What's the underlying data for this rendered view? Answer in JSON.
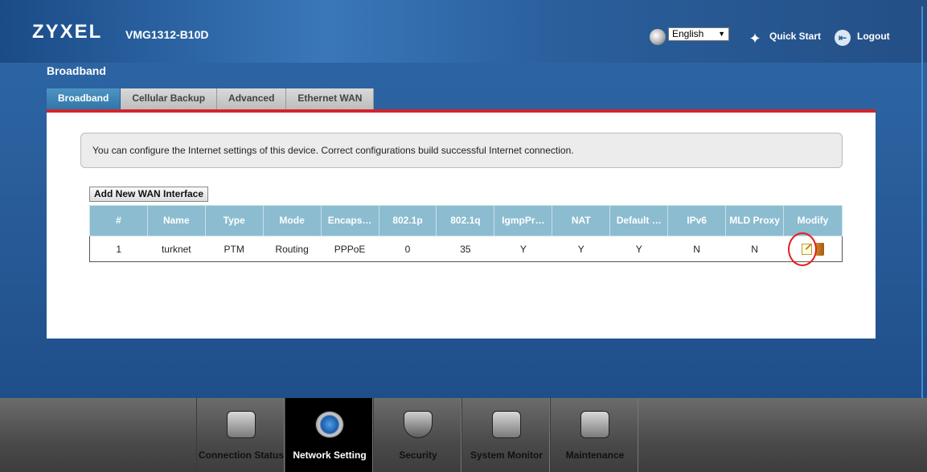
{
  "header": {
    "logo": "ZYXEL",
    "model": "VMG1312-B10D",
    "language": "English",
    "quick_start": "Quick Start",
    "logout": "Logout"
  },
  "page": {
    "title": "Broadband"
  },
  "tabs": [
    {
      "label": "Broadband",
      "active": true
    },
    {
      "label": "Cellular Backup",
      "active": false
    },
    {
      "label": "Advanced",
      "active": false
    },
    {
      "label": "Ethernet WAN",
      "active": false
    }
  ],
  "info": "You can configure the Internet settings of this device. Correct configurations build successful Internet connection.",
  "add_button": "Add New WAN Interface",
  "table": {
    "headers": [
      "#",
      "Name",
      "Type",
      "Mode",
      "Encaps…",
      "802.1p",
      "802.1q",
      "IgmpPr…",
      "NAT",
      "Default …",
      "IPv6",
      "MLD Proxy",
      "Modify"
    ],
    "rows": [
      [
        "1",
        "turknet",
        "PTM",
        "Routing",
        "PPPoE",
        "0",
        "35",
        "Y",
        "Y",
        "Y",
        "N",
        "N"
      ]
    ]
  },
  "nav": [
    {
      "label": "Connection Status",
      "icon": "monitor-icon"
    },
    {
      "label": "Network Setting",
      "icon": "gear-icon",
      "active": true
    },
    {
      "label": "Security",
      "icon": "shield-icon"
    },
    {
      "label": "System Monitor",
      "icon": "chart-icon"
    },
    {
      "label": "Maintenance",
      "icon": "tools-icon"
    }
  ],
  "colors": {
    "background": "#2a5f9c",
    "tab_active": "#3a82b4",
    "accent_strip": "#d4242c",
    "table_header": "#8cbccf",
    "highlight": "#e41d1d"
  }
}
